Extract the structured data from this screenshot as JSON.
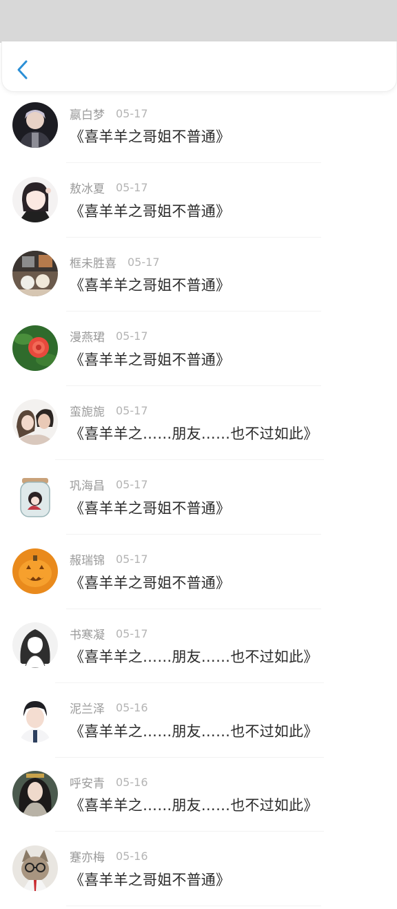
{
  "header": {
    "back_icon": "chevron-left-icon",
    "accent": "#2b8fd6"
  },
  "comments": [
    {
      "name": "嬴白梦",
      "date": "05-17",
      "text": "《喜羊羊之哥姐不普通》"
    },
    {
      "name": "敖冰夏",
      "date": "05-17",
      "text": "《喜羊羊之哥姐不普通》"
    },
    {
      "name": "框未胜喜",
      "date": "05-17",
      "text": "《喜羊羊之哥姐不普通》"
    },
    {
      "name": "漫燕珺",
      "date": "05-17",
      "text": "《喜羊羊之哥姐不普通》"
    },
    {
      "name": "蛮旎旎",
      "date": "05-17",
      "text": "《喜羊羊之……朋友……也不过如此》"
    },
    {
      "name": "巩海昌",
      "date": "05-17",
      "text": "《喜羊羊之哥姐不普通》"
    },
    {
      "name": "赧瑞锦",
      "date": "05-17",
      "text": "《喜羊羊之哥姐不普通》"
    },
    {
      "name": "书寒凝",
      "date": "05-17",
      "text": "《喜羊羊之……朋友……也不过如此》"
    },
    {
      "name": "泥兰泽",
      "date": "05-16",
      "text": "《喜羊羊之……朋友……也不过如此》"
    },
    {
      "name": "呼安青",
      "date": "05-16",
      "text": "《喜羊羊之……朋友……也不过如此》"
    },
    {
      "name": "蹇亦梅",
      "date": "05-16",
      "text": "《喜羊羊之哥姐不普通》"
    }
  ]
}
